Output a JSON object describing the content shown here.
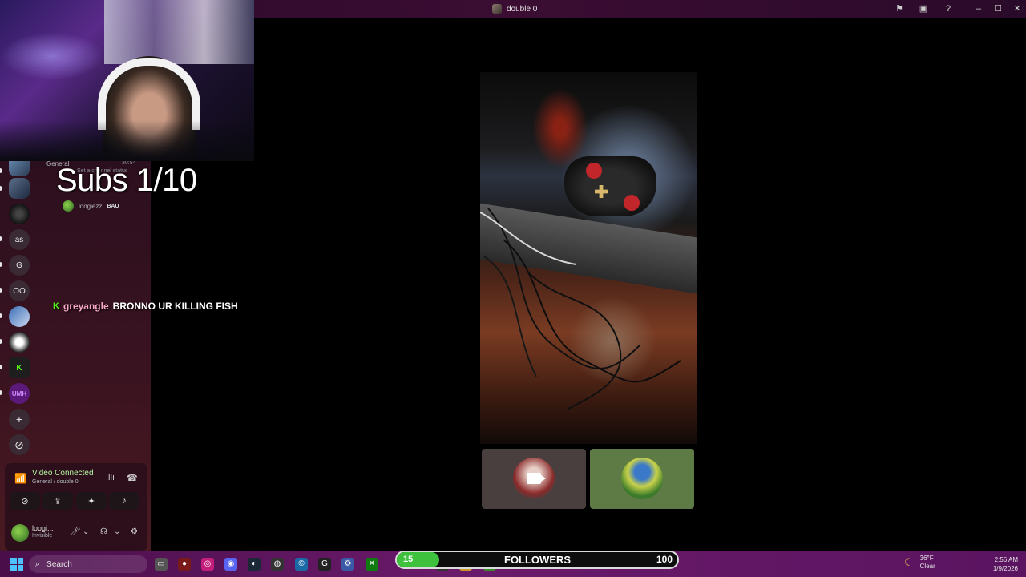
{
  "window": {
    "title": "double 0",
    "icons": [
      "flag-icon",
      "inbox-icon",
      "help-icon"
    ],
    "controls": [
      "minimize-icon",
      "maximize-icon",
      "close-icon"
    ]
  },
  "sidebar": {
    "guilds": [
      {
        "label": ""
      },
      {
        "label": ""
      },
      {
        "label": ""
      },
      {
        "label": "as"
      },
      {
        "label": "G"
      },
      {
        "label": "OO"
      },
      {
        "label": ""
      },
      {
        "label": ""
      },
      {
        "label": "K"
      },
      {
        "label": "UMH"
      },
      {
        "label": "+"
      },
      {
        "label": "⊘"
      }
    ],
    "channel": {
      "name": "General",
      "status": "Set a channel status",
      "timer": "30:54"
    },
    "voice_user": {
      "name": "loogiezz",
      "tag": "BAU"
    }
  },
  "overlay": {
    "subs_counter": "Subs 1/10",
    "chat": {
      "platform_badge": "K",
      "username": "greyangle",
      "message": "BRONNO UR KILLING FISH"
    }
  },
  "voice_panel": {
    "title": "Video Connected",
    "subtitle": "General / double 0",
    "buttons": [
      "camera-off-icon",
      "screen-share-icon",
      "activities-icon",
      "soundboard-icon"
    ],
    "user": {
      "name": "loogi...",
      "status": "Invisible"
    }
  },
  "call": {
    "tiles": [
      {
        "name": "participant-camera-off"
      },
      {
        "name": "participant-avatar"
      }
    ]
  },
  "taskbar": {
    "search_label": "Search",
    "followers": {
      "current": "15",
      "label": "FOLLOWERS",
      "goal": "100",
      "progress": 0.15
    },
    "weather": {
      "temp": "36°F",
      "condition": "Clear"
    },
    "clock": {
      "time": "2:56 AM",
      "date": "1/9/2026"
    }
  }
}
